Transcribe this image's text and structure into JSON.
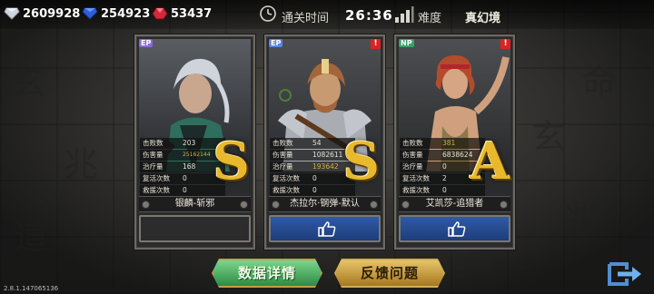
{
  "resources": {
    "silver": "2609928",
    "sapphire": "254923",
    "ruby": "53437"
  },
  "header": {
    "clear_time_label": "通关时间",
    "clear_time": "26:36",
    "difficulty_label": "难度",
    "difficulty_value": "真幻境"
  },
  "stat_labels": [
    "击败数",
    "伤害量",
    "治疗量",
    "复活次数",
    "救援次数"
  ],
  "cards": [
    {
      "badge": "EP",
      "badge_color": "#8a6ad6",
      "alert": false,
      "stats": [
        "203",
        "25162144",
        "168",
        "0",
        "0"
      ],
      "highlight": [
        false,
        true,
        false,
        false,
        false
      ],
      "grade": "S",
      "name": "银麟-斩邪",
      "liked": false
    },
    {
      "badge": "EP",
      "badge_color": "#5a86e0",
      "alert": true,
      "stats": [
        "54",
        "1082611",
        "193642",
        "0",
        "0"
      ],
      "highlight": [
        false,
        false,
        true,
        false,
        false
      ],
      "grade": "S",
      "name": "杰拉尔·钢弹-默认",
      "liked": true
    },
    {
      "badge": "NP",
      "badge_color": "#3aa36b",
      "alert": true,
      "stats": [
        "381",
        "6838624",
        "0",
        "2",
        "0"
      ],
      "highlight": [
        true,
        false,
        false,
        false,
        false
      ],
      "grade": "A",
      "name": "艾凯莎-追猎者",
      "liked": true
    }
  ],
  "buttons": {
    "details": "数据详情",
    "feedback": "反馈问题"
  },
  "version": "2.8.1.147065136",
  "colors": {
    "accent_gold": "#e8b92c",
    "like_blue": "#2f5aa6",
    "button_green": "#2e8a45"
  }
}
